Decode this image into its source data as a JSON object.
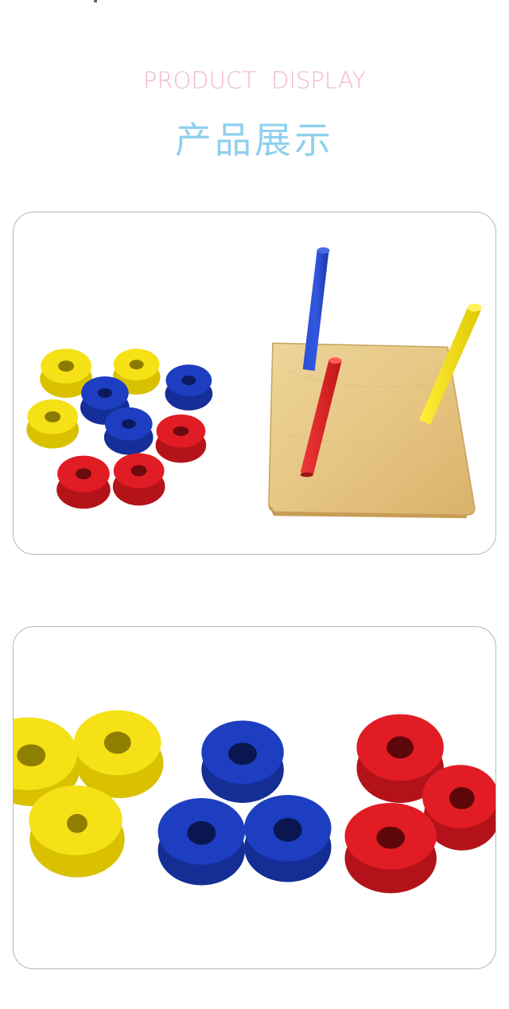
{
  "header": {
    "title_en": "PRODUCT  DISPLAY",
    "title_cn": "产品展示",
    "title_en_color": "#f2b8c8",
    "title_cn_color": "#8fd0ee"
  },
  "photos": [
    {
      "subject": "wooden stacking toy: square board with blue, red and yellow pegs beside blue, red and yellow rings",
      "colors": {
        "yellow": "#f5e116",
        "blue": "#1d3ec0",
        "red": "#e21c24",
        "wood": "#e8c984"
      }
    },
    {
      "subject": "close-up of three groups of three rings: yellow, blue and red",
      "colors": {
        "yellow": "#f5e116",
        "blue": "#1d3ec0",
        "red": "#e21c24"
      }
    }
  ]
}
